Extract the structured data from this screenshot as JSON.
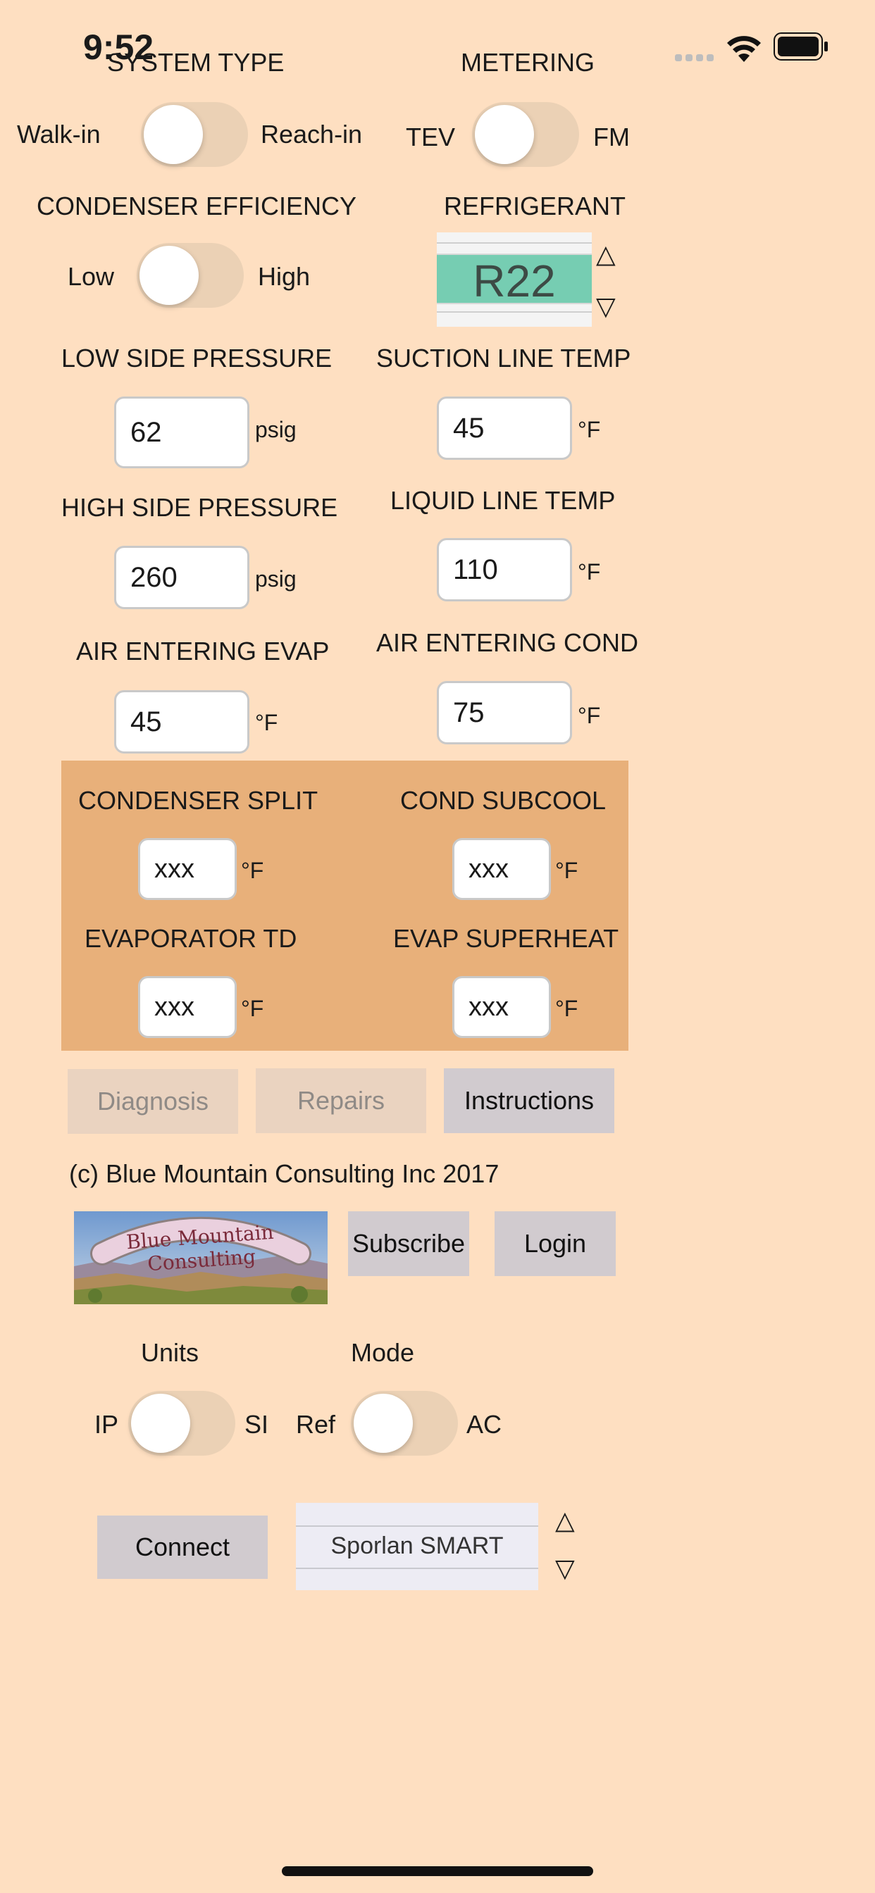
{
  "status_bar": {
    "time": "9:52"
  },
  "system_type": {
    "title": "SYSTEM TYPE",
    "left": "Walk-in",
    "right": "Reach-in"
  },
  "metering": {
    "title": "METERING",
    "left": "TEV",
    "right": "FM"
  },
  "condenser_efficiency": {
    "title": "CONDENSER EFFICIENCY",
    "left": "Low",
    "right": "High"
  },
  "refrigerant": {
    "title": "REFRIGERANT",
    "value": "R22",
    "up": "△",
    "down": "▽"
  },
  "inputs": {
    "low_side_pressure": {
      "label": "LOW SIDE PRESSURE",
      "value": "62",
      "unit": "psig"
    },
    "suction_line_temp": {
      "label": "SUCTION LINE TEMP",
      "value": "45",
      "unit": "°F"
    },
    "high_side_pressure": {
      "label": "HIGH SIDE PRESSURE",
      "value": "260",
      "unit": "psig"
    },
    "liquid_line_temp": {
      "label": "LIQUID LINE TEMP",
      "value": "110",
      "unit": "°F"
    },
    "air_entering_evap": {
      "label": "AIR ENTERING EVAP",
      "value": "45",
      "unit": "°F"
    },
    "air_entering_cond": {
      "label": "AIR ENTERING COND",
      "value": "75",
      "unit": "°F"
    }
  },
  "results": {
    "condenser_split": {
      "label": "CONDENSER SPLIT",
      "value": "xxx",
      "unit": "°F"
    },
    "cond_subcool": {
      "label": "COND SUBCOOL",
      "value": "xxx",
      "unit": "°F"
    },
    "evaporator_td": {
      "label": "EVAPORATOR TD",
      "value": "xxx",
      "unit": "°F"
    },
    "evap_superheat": {
      "label": "EVAP SUPERHEAT",
      "value": "xxx",
      "unit": "°F"
    }
  },
  "buttons": {
    "diagnosis": "Diagnosis",
    "repairs": "Repairs",
    "instructions": "Instructions",
    "subscribe": "Subscribe",
    "login": "Login",
    "connect": "Connect"
  },
  "copyright": "(c) Blue Mountain Consulting Inc 2017",
  "logo": {
    "text": "Blue Mountain Consulting"
  },
  "units": {
    "title": "Units",
    "left": "IP",
    "right": "SI"
  },
  "mode": {
    "title": "Mode",
    "left": "Ref",
    "right": "AC"
  },
  "device_picker": {
    "value": "Sporlan SMART",
    "up": "△",
    "down": "▽"
  },
  "colors": {
    "background": "#FEDFC1",
    "panel": "#E8B07A",
    "refrigerant_band": "#76CDB2"
  }
}
